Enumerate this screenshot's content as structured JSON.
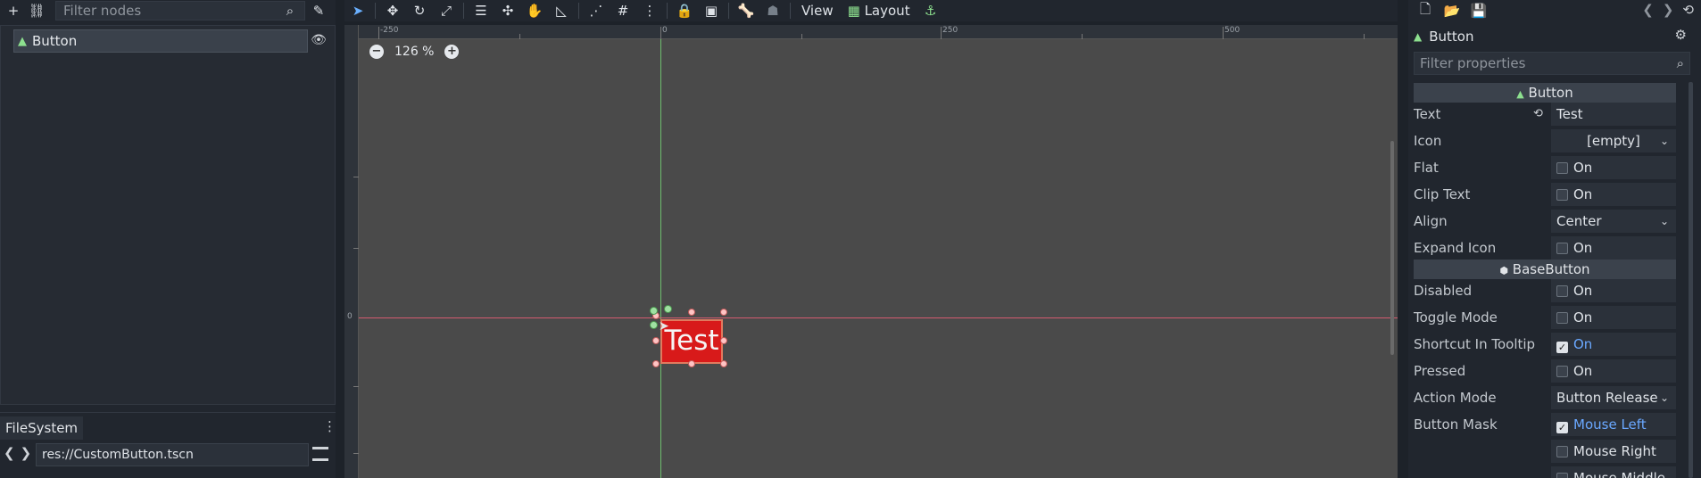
{
  "scene": {
    "filter_placeholder": "Filter nodes",
    "tree": [
      {
        "label": "Button"
      }
    ]
  },
  "filesystem": {
    "tab_label": "FileSystem",
    "path": "res://CustomButton.tscn"
  },
  "viewport_toolbar": {
    "view_label": "View",
    "layout_label": "Layout"
  },
  "viewport": {
    "zoom_label": "126 %",
    "ruler_h": [
      "-250",
      "0",
      "250",
      "500"
    ],
    "ruler_v": [
      "0"
    ],
    "button_text": "Test"
  },
  "inspector": {
    "object_name": "Button",
    "filter_placeholder": "Filter properties",
    "section_button": "Button",
    "section_basebutton": "BaseButton",
    "props": {
      "text": {
        "name": "Text",
        "value": "Test"
      },
      "icon": {
        "name": "Icon",
        "value": "[empty]"
      },
      "flat": {
        "name": "Flat",
        "value": "On"
      },
      "clip_text": {
        "name": "Clip Text",
        "value": "On"
      },
      "align": {
        "name": "Align",
        "value": "Center"
      },
      "expand_icon": {
        "name": "Expand Icon",
        "value": "On"
      },
      "disabled": {
        "name": "Disabled",
        "value": "On"
      },
      "toggle_mode": {
        "name": "Toggle Mode",
        "value": "On"
      },
      "shortcut_tooltip": {
        "name": "Shortcut In Tooltip",
        "value": "On"
      },
      "pressed": {
        "name": "Pressed",
        "value": "On"
      },
      "action_mode": {
        "name": "Action Mode",
        "value": "Button Release"
      },
      "button_mask": {
        "name": "Button Mask",
        "value1": "Mouse Left",
        "value2": "Mouse Right",
        "value3": "Mouse Middle"
      }
    }
  },
  "colors": {
    "accent": "#6aa8ff",
    "button_red": "#d81a1a",
    "axis_green": "#6fbf6f",
    "axis_red": "#d45b70"
  }
}
